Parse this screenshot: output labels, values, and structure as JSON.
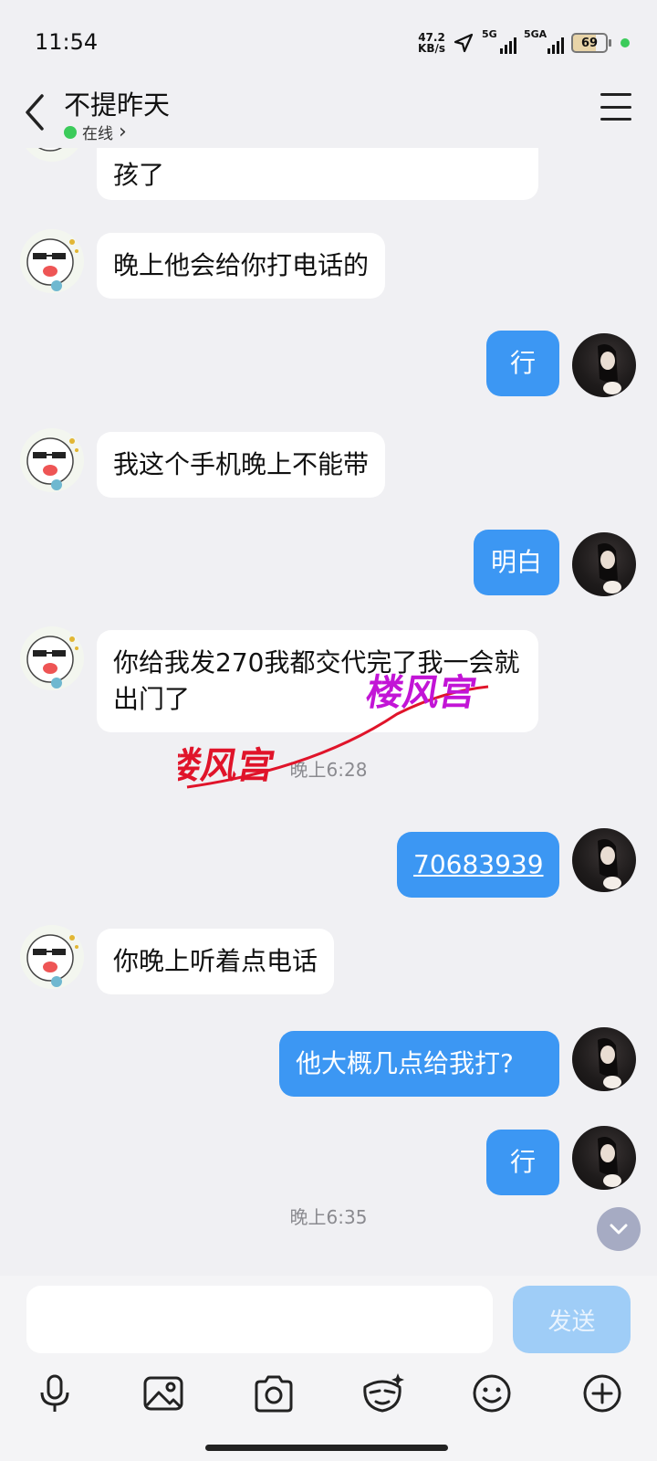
{
  "status_bar": {
    "time": "11:54",
    "speed_value": "47.2",
    "speed_unit": "KB/s",
    "sim1_label": "5G",
    "sim2_label": "5GA",
    "battery": "69"
  },
  "header": {
    "title": "不提昨天",
    "status": "在线",
    "status_chevron": "›"
  },
  "messages": [
    {
      "side": "them",
      "text": "孩了"
    },
    {
      "side": "them",
      "text": "晚上他会给你打电话的"
    },
    {
      "side": "me",
      "text": "行"
    },
    {
      "side": "them",
      "text": "我这个手机晚上不能带"
    },
    {
      "side": "me",
      "text": "明白"
    },
    {
      "side": "them",
      "text": "你给我发270我都交代完了我一会就出门了"
    },
    {
      "side": "me",
      "text": "70683939"
    },
    {
      "side": "them",
      "text": "你晚上听着点电话"
    },
    {
      "side": "me",
      "text": "他大概几点给我打?"
    },
    {
      "side": "me",
      "text": "行"
    }
  ],
  "timestamps": [
    "晚上6:28",
    "晚上6:35"
  ],
  "watermark": {
    "text": "楼风宫"
  },
  "input": {
    "placeholder": "",
    "send_label": "发送"
  },
  "toolbar": [
    "microphone-icon",
    "image-icon",
    "camera-icon",
    "sticker-icon",
    "emoji-icon",
    "plus-icon"
  ],
  "colors": {
    "my_bubble": "#3c97f3",
    "send_disabled": "#9fcdf7",
    "online": "#3ccb5b",
    "background": "#f0f0f3"
  }
}
